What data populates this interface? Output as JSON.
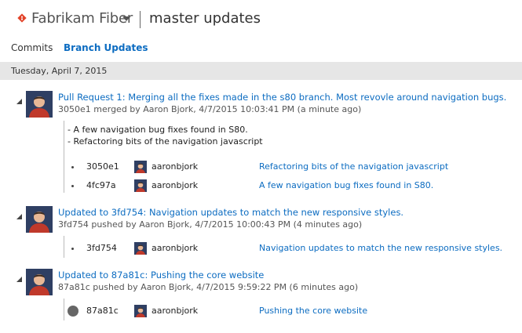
{
  "header": {
    "repo_name": "Fabrikam Fiber",
    "page_title": "master updates",
    "icons": {
      "repo": "git-diamond-icon",
      "caret": "chevron-down-icon"
    },
    "colors": {
      "git_icon": "#e24329",
      "link": "#0c6cc1"
    }
  },
  "tabs": [
    {
      "label": "Commits",
      "selected": false
    },
    {
      "label": "Branch Updates",
      "selected": true
    }
  ],
  "date_group": "Tuesday, April 7, 2015",
  "updates": [
    {
      "title": "Pull Request 1: Merging all the fixes made in the s80 branch. Most revovle around navigation bugs.",
      "subtitle": "3050e1 merged by Aaron Bjork, 4/7/2015 10:03:41 PM (a minute ago)",
      "description": [
        "- A few navigation bug fixes found in S80.",
        "- Refactoring bits of the navigation javascript"
      ],
      "commits": [
        {
          "hash": "3050e1",
          "author": "aaronbjork",
          "message": "Refactoring bits of the navigation javascript"
        },
        {
          "hash": "4fc97a",
          "author": "aaronbjork",
          "message": "A few navigation bug fixes found in S80."
        }
      ]
    },
    {
      "title": "Updated to 3fd754: Navigation updates to match the new responsive styles.",
      "subtitle": "3fd754 pushed by Aaron Bjork, 4/7/2015 10:00:43 PM (4 minutes ago)",
      "commits": [
        {
          "hash": "3fd754",
          "author": "aaronbjork",
          "message": "Navigation updates to match the new responsive styles."
        }
      ]
    },
    {
      "title": "Updated to 87a81c: Pushing the core website",
      "subtitle": "87a81c pushed by Aaron Bjork, 4/7/2015 9:59:22 PM (6 minutes ago)",
      "commits": [
        {
          "hash": "87a81c",
          "author": "aaronbjork",
          "message": "Pushing the core website"
        }
      ]
    }
  ]
}
